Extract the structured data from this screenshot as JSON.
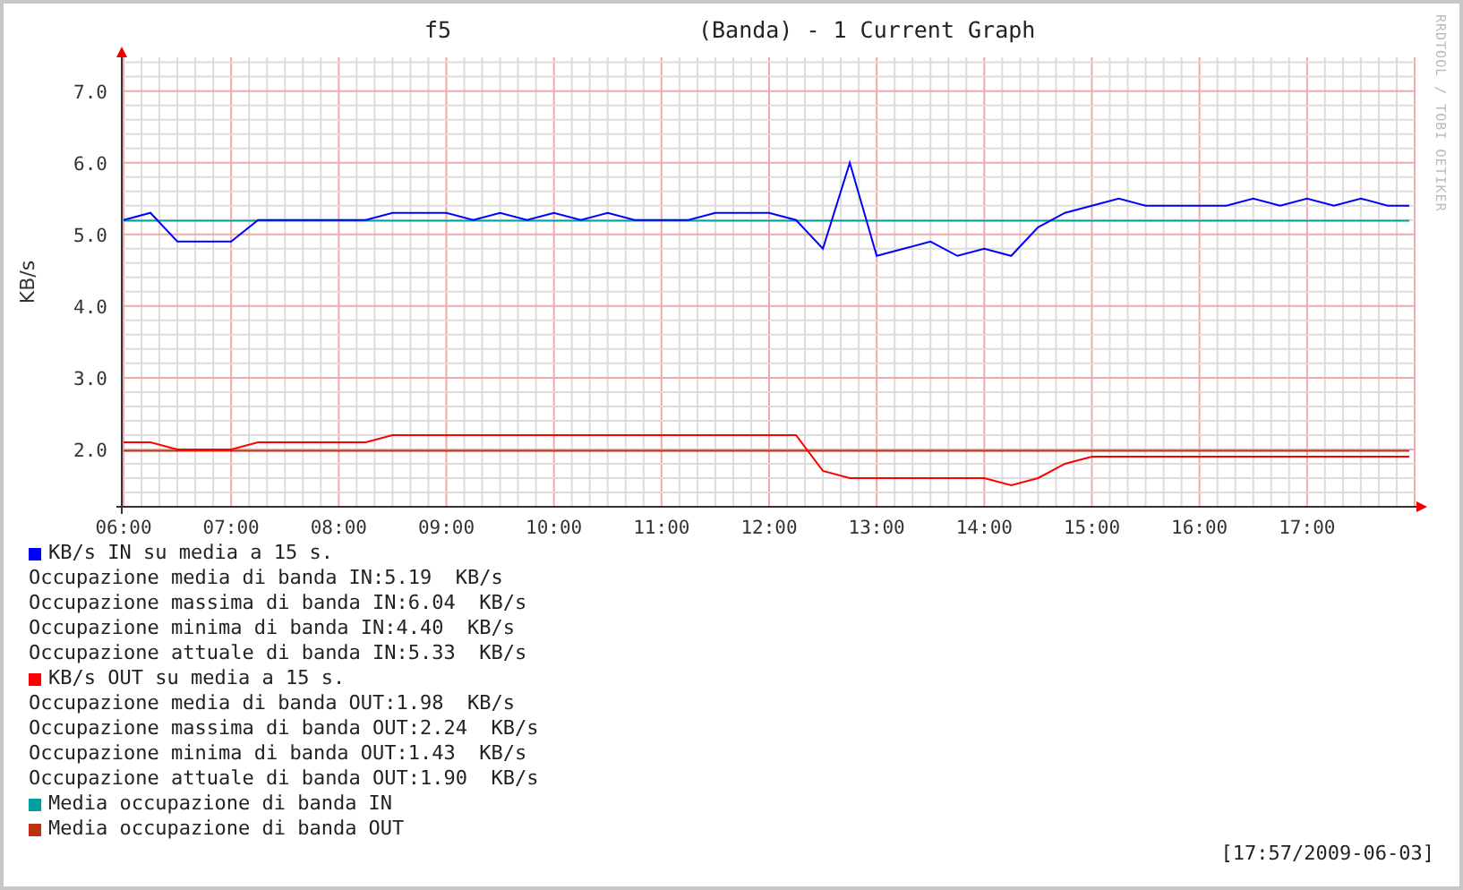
{
  "title": "f5",
  "subtitle": "(Banda) - 1 Current Graph",
  "credit": "RRDTOOL / TOBI OETIKER",
  "chart": {
    "chart_data": {
      "type": "line",
      "ylabel": "KB/s",
      "grid": true,
      "x": [
        6,
        6.25,
        6.5,
        6.75,
        7,
        7.25,
        7.5,
        7.75,
        8,
        8.25,
        8.5,
        8.75,
        9,
        9.25,
        9.5,
        9.75,
        10,
        10.25,
        10.5,
        10.75,
        11,
        11.25,
        11.5,
        11.75,
        12,
        12.25,
        12.5,
        12.75,
        13,
        13.25,
        13.5,
        13.75,
        14,
        14.25,
        14.5,
        14.75,
        15,
        15.25,
        15.5,
        15.75,
        16,
        16.25,
        16.5,
        16.75,
        17,
        17.25,
        17.5,
        17.75,
        17.95
      ],
      "series": [
        {
          "name": "KB/s IN su media a 15 s.",
          "color": "#0000ff",
          "values": [
            5.2,
            5.3,
            4.9,
            4.9,
            4.9,
            5.2,
            5.2,
            5.2,
            5.2,
            5.2,
            5.3,
            5.3,
            5.3,
            5.2,
            5.3,
            5.2,
            5.3,
            5.2,
            5.3,
            5.2,
            5.2,
            5.2,
            5.3,
            5.3,
            5.3,
            5.2,
            4.8,
            6.0,
            4.7,
            4.8,
            4.9,
            4.7,
            4.8,
            4.7,
            5.1,
            5.3,
            5.4,
            5.5,
            5.4,
            5.4,
            5.4,
            5.4,
            5.5,
            5.4,
            5.5,
            5.4,
            5.5,
            5.4,
            5.4
          ]
        },
        {
          "name": "KB/s OUT su media a 15 s.",
          "color": "#ff0000",
          "values": [
            2.1,
            2.1,
            2.0,
            2.0,
            2.0,
            2.1,
            2.1,
            2.1,
            2.1,
            2.1,
            2.2,
            2.2,
            2.2,
            2.2,
            2.2,
            2.2,
            2.2,
            2.2,
            2.2,
            2.2,
            2.2,
            2.2,
            2.2,
            2.2,
            2.2,
            2.2,
            1.7,
            1.6,
            1.6,
            1.6,
            1.6,
            1.6,
            1.6,
            1.5,
            1.6,
            1.8,
            1.9,
            1.9,
            1.9,
            1.9,
            1.9,
            1.9,
            1.9,
            1.9,
            1.9,
            1.9,
            1.9,
            1.9,
            1.9
          ]
        },
        {
          "name": "Media occupazione di banda IN",
          "color": "#00a0a0",
          "values": [
            5.19,
            5.19,
            5.19,
            5.19,
            5.19,
            5.19,
            5.19,
            5.19,
            5.19,
            5.19,
            5.19,
            5.19,
            5.19,
            5.19,
            5.19,
            5.19,
            5.19,
            5.19,
            5.19,
            5.19,
            5.19,
            5.19,
            5.19,
            5.19,
            5.19,
            5.19,
            5.19,
            5.19,
            5.19,
            5.19,
            5.19,
            5.19,
            5.19,
            5.19,
            5.19,
            5.19,
            5.19,
            5.19,
            5.19,
            5.19,
            5.19,
            5.19,
            5.19,
            5.19,
            5.19,
            5.19,
            5.19,
            5.19,
            5.19
          ]
        },
        {
          "name": "Media occupazione di banda OUT",
          "color": "#c03010",
          "values": [
            1.98,
            1.98,
            1.98,
            1.98,
            1.98,
            1.98,
            1.98,
            1.98,
            1.98,
            1.98,
            1.98,
            1.98,
            1.98,
            1.98,
            1.98,
            1.98,
            1.98,
            1.98,
            1.98,
            1.98,
            1.98,
            1.98,
            1.98,
            1.98,
            1.98,
            1.98,
            1.98,
            1.98,
            1.98,
            1.98,
            1.98,
            1.98,
            1.98,
            1.98,
            1.98,
            1.98,
            1.98,
            1.98,
            1.98,
            1.98,
            1.98,
            1.98,
            1.98,
            1.98,
            1.98,
            1.98,
            1.98,
            1.98,
            1.98
          ]
        }
      ],
      "xlim": [
        6,
        18
      ],
      "ylim": [
        1.2,
        7.47
      ],
      "xticks": [
        {
          "value": 6,
          "label": "06:00"
        },
        {
          "value": 7,
          "label": "07:00"
        },
        {
          "value": 8,
          "label": "08:00"
        },
        {
          "value": 9,
          "label": "09:00"
        },
        {
          "value": 10,
          "label": "10:00"
        },
        {
          "value": 11,
          "label": "11:00"
        },
        {
          "value": 12,
          "label": "12:00"
        },
        {
          "value": 13,
          "label": "13:00"
        },
        {
          "value": 14,
          "label": "14:00"
        },
        {
          "value": 15,
          "label": "15:00"
        },
        {
          "value": 16,
          "label": "16:00"
        },
        {
          "value": 17,
          "label": "17:00"
        }
      ],
      "yticks": [
        {
          "value": 2,
          "label": "2.0"
        },
        {
          "value": 3,
          "label": "3.0"
        },
        {
          "value": 4,
          "label": "4.0"
        },
        {
          "value": 5,
          "label": "5.0"
        },
        {
          "value": 6,
          "label": "6.0"
        },
        {
          "value": 7,
          "label": "7.0"
        }
      ]
    }
  },
  "legend": [
    {
      "kind": "series"
    },
    {
      "kind": "stat",
      "text": "Occupazione media di banda IN:5.19  KB/s"
    },
    {
      "kind": "stat",
      "text": "Occupazione massima di banda IN:6.04  KB/s"
    },
    {
      "kind": "stat",
      "text": "Occupazione minima di banda IN:4.40  KB/s"
    },
    {
      "kind": "stat",
      "text": "Occupazione attuale di banda IN:5.33  KB/s"
    },
    {
      "kind": "series"
    },
    {
      "kind": "stat",
      "text": "Occupazione media di banda OUT:1.98  KB/s"
    },
    {
      "kind": "stat",
      "text": "Occupazione massima di banda OUT:2.24  KB/s"
    },
    {
      "kind": "stat",
      "text": "Occupazione minima di banda OUT:1.43  KB/s"
    },
    {
      "kind": "stat",
      "text": "Occupazione attuale di banda OUT:1.90  KB/s"
    },
    {
      "kind": "series"
    },
    {
      "kind": "series"
    }
  ],
  "timestamp": "[17:57/2009-06-03]"
}
